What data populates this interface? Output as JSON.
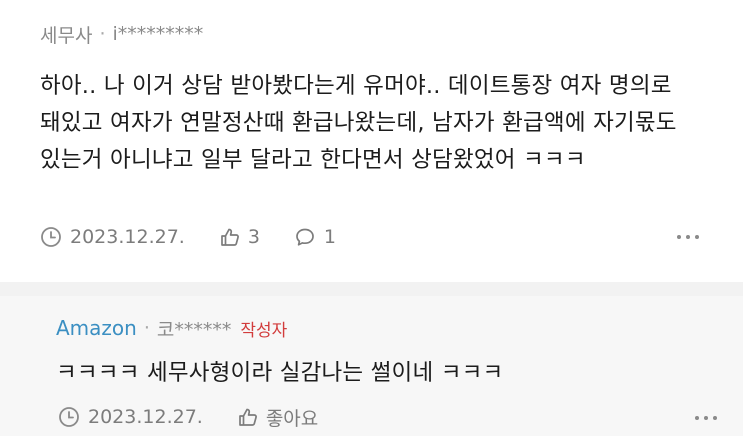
{
  "comment": {
    "author": "세무사",
    "separator": "·",
    "masked_id": "i*********",
    "text": "하아.. 나 이거 상담 받아봤다는게 유머야.. 데이트통장 여자 명의로 돼있고 여자가 연말정산때 환급나왔는데, 남자가 환급액에 자기몫도 있는거 아니냐고 일부 달라고 한다면서 상담왔었어 ㅋㅋㅋ",
    "date": "2023.12.27.",
    "likes": "3",
    "replies": "1"
  },
  "reply": {
    "author": "Amazon",
    "separator": "·",
    "masked_id": "코******",
    "writer_badge": "작성자",
    "text": "ㅋㅋㅋㅋ 세무사형이라 실감나는 썰이네 ㅋㅋㅋ",
    "date": "2023.12.27.",
    "like_label": "좋아요"
  },
  "colors": {
    "author_reply": "#3b8fc2",
    "writer_badge": "#d23c3c",
    "meta_gray": "#8a8a8a",
    "divider": "#f2f2f2",
    "reply_bg": "#f7f7f7"
  },
  "icons": [
    "clock-icon",
    "thumbs-up-icon",
    "speech-bubble-icon",
    "more-dots-icon"
  ]
}
